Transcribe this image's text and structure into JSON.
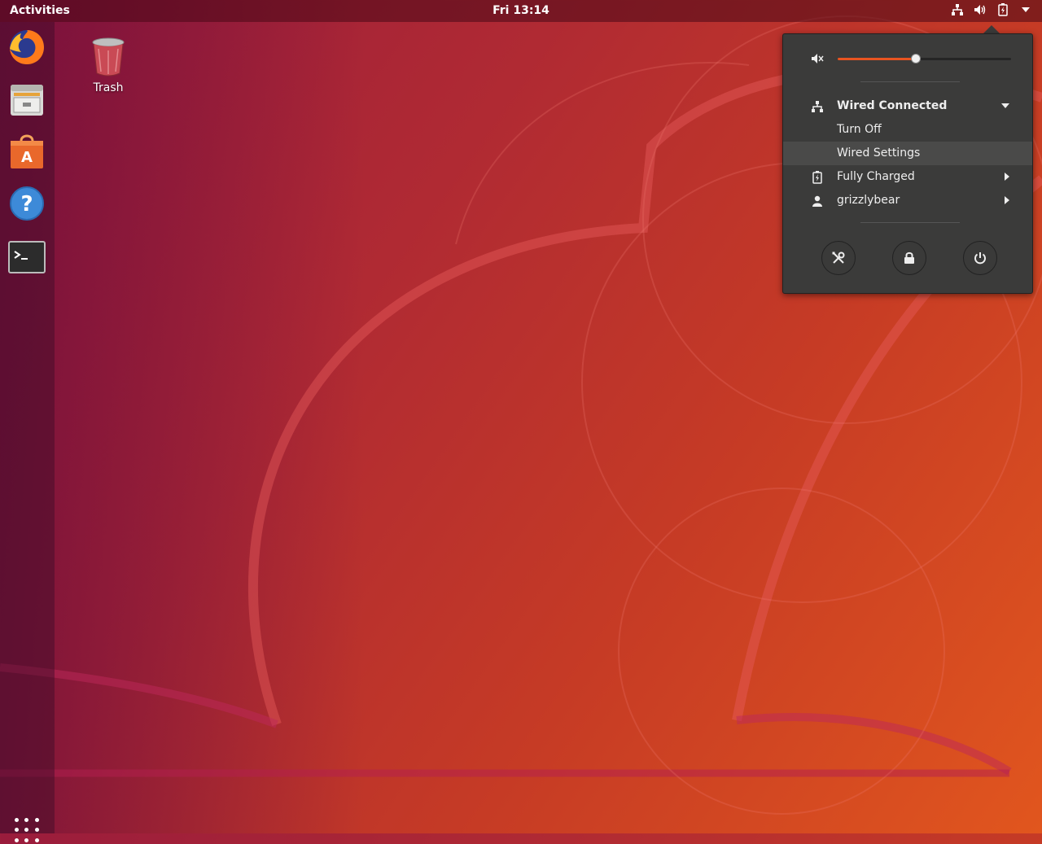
{
  "topbar": {
    "activities": "Activities",
    "clock": "Fri 13:14"
  },
  "desktop": {
    "trash_label": "Trash"
  },
  "dock": {
    "items": [
      "firefox-icon",
      "files-icon",
      "software-icon",
      "help-icon",
      "terminal-icon"
    ],
    "apps_button": "show-applications-icon"
  },
  "system_menu": {
    "volume_level": 0.45,
    "network_title": "Wired Connected",
    "network_items": [
      "Turn Off",
      "Wired Settings"
    ],
    "battery": "Fully Charged",
    "user": "grizzlybear"
  },
  "colors": {
    "accent": "#e95420",
    "menu_bg": "#3b3b3a"
  }
}
